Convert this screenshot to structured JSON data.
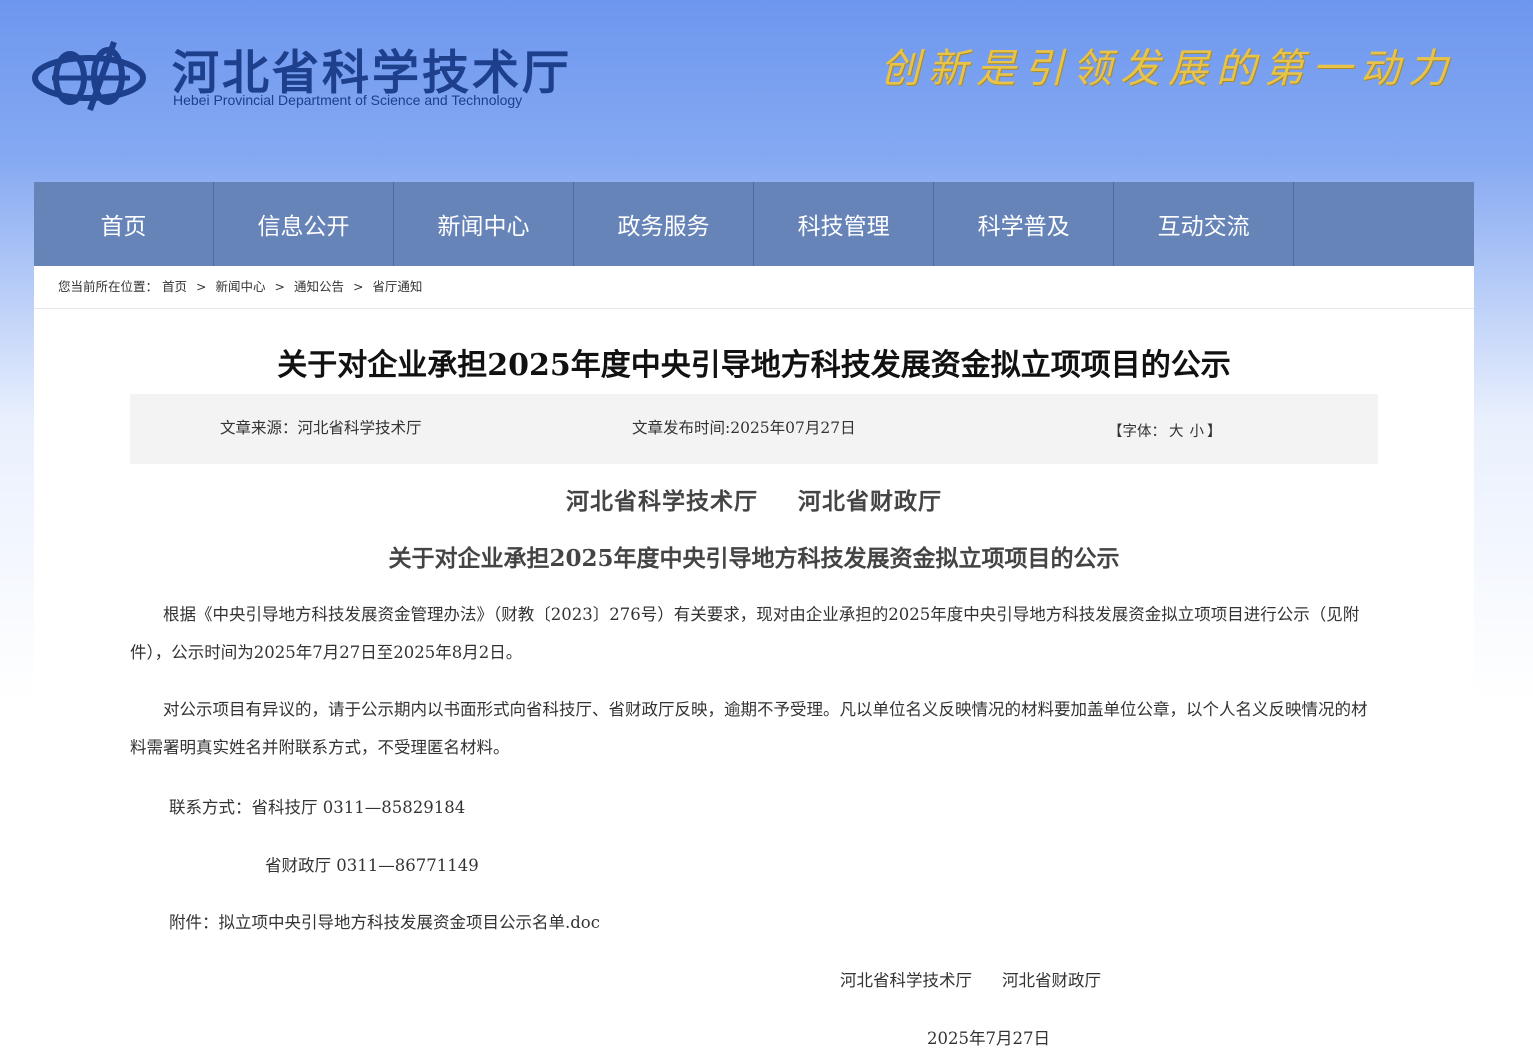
{
  "header": {
    "site_title": "河北省科学技术厅",
    "site_subtitle": "Hebei Provincial Department of Science and Technology",
    "slogan": "创新是引领发展的第一动力",
    "logo_icon": "department-emblem-icon"
  },
  "nav": {
    "items": [
      "首页",
      "信息公开",
      "新闻中心",
      "政务服务",
      "科技管理",
      "科学普及",
      "互动交流"
    ]
  },
  "breadcrumb": {
    "prefix": "您当前所在位置：",
    "items": [
      "首页",
      "新闻中心",
      "通知公告",
      "省厅通知"
    ],
    "separator": ">"
  },
  "article": {
    "title": "关于对企业承担2025年度中央引导地方科技发展资金拟立项项目的公示",
    "meta": {
      "source": "文章来源：河北省科学技术厅",
      "date": "文章发布时间:2025年07月27日",
      "font_label_open": "【字体：",
      "font_large": "大",
      "font_small": "小",
      "font_label_close": "】"
    },
    "orgs": [
      "河北省科学技术厅",
      "河北省财政厅"
    ],
    "subtitle": "关于对企业承担2025年度中央引导地方科技发展资金拟立项项目的公示",
    "paragraph1": "根据《中央引导地方科技发展资金管理办法》（财教〔2023〕276号）有关要求，现对由企业承担的2025年度中央引导地方科技发展资金拟立项项目进行公示（见附件），公示时间为2025年7月27日至2025年8月2日。",
    "paragraph2": "对公示项目有异议的，请于公示期内以书面形式向省科技厅、省财政厅反映，逾期不予受理。凡以单位名义反映情况的材料要加盖单位公章，以个人名义反映情况的材料需署明真实姓名并附联系方式，不受理匿名材料。",
    "contact1": "联系方式：省科技厅 0311—85829184",
    "contact2": "省财政厅 0311—86771149",
    "attachment_label": "附件：",
    "attachment_link": "拟立项中央引导地方科技发展资金项目公示名单.doc",
    "signature": [
      "河北省科学技术厅",
      "河北省财政厅"
    ],
    "sign_date": "2025年7月27日"
  },
  "colors": {
    "nav_bg": "#6784b9",
    "title_blue": "#1d3f8c",
    "slogan_gold": "#e8c34a",
    "meta_bg": "#f3f3f3"
  }
}
